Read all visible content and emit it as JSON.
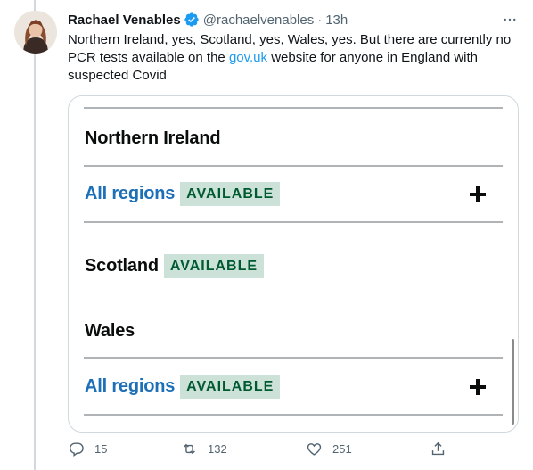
{
  "author": {
    "name": "Rachael Venables",
    "handle": "@rachaelvenables",
    "separator": "·",
    "time": "13h",
    "verified_icon": "verified-badge-icon",
    "avatar_icon": "profile-photo"
  },
  "tweet": {
    "text_before_link": "Northern Ireland, yes, Scotland, yes, Wales, yes. But there are currently no PCR tests available on the ",
    "link_text": "gov.uk",
    "text_after_link": " website for anyone in England with suspected Covid"
  },
  "screenshot": {
    "northern_ireland": {
      "heading": "Northern Ireland"
    },
    "row1": {
      "link": "All regions",
      "status": "AVAILABLE",
      "expand_icon": "plus-icon"
    },
    "scotland": {
      "heading": "Scotland",
      "status": "AVAILABLE"
    },
    "wales": {
      "heading": "Wales"
    },
    "row2": {
      "link": "All regions",
      "status": "AVAILABLE",
      "expand_icon": "plus-icon"
    }
  },
  "actions": {
    "reply_count": "15",
    "retweet_count": "132",
    "like_count": "251",
    "icons": [
      "reply-icon",
      "retweet-icon",
      "like-icon",
      "share-icon"
    ]
  },
  "colors": {
    "link_blue": "#1d9bf0",
    "govuk_link": "#1d70b8",
    "tag_bg": "#cce2d8",
    "tag_text": "#005a30",
    "muted": "#536471"
  }
}
